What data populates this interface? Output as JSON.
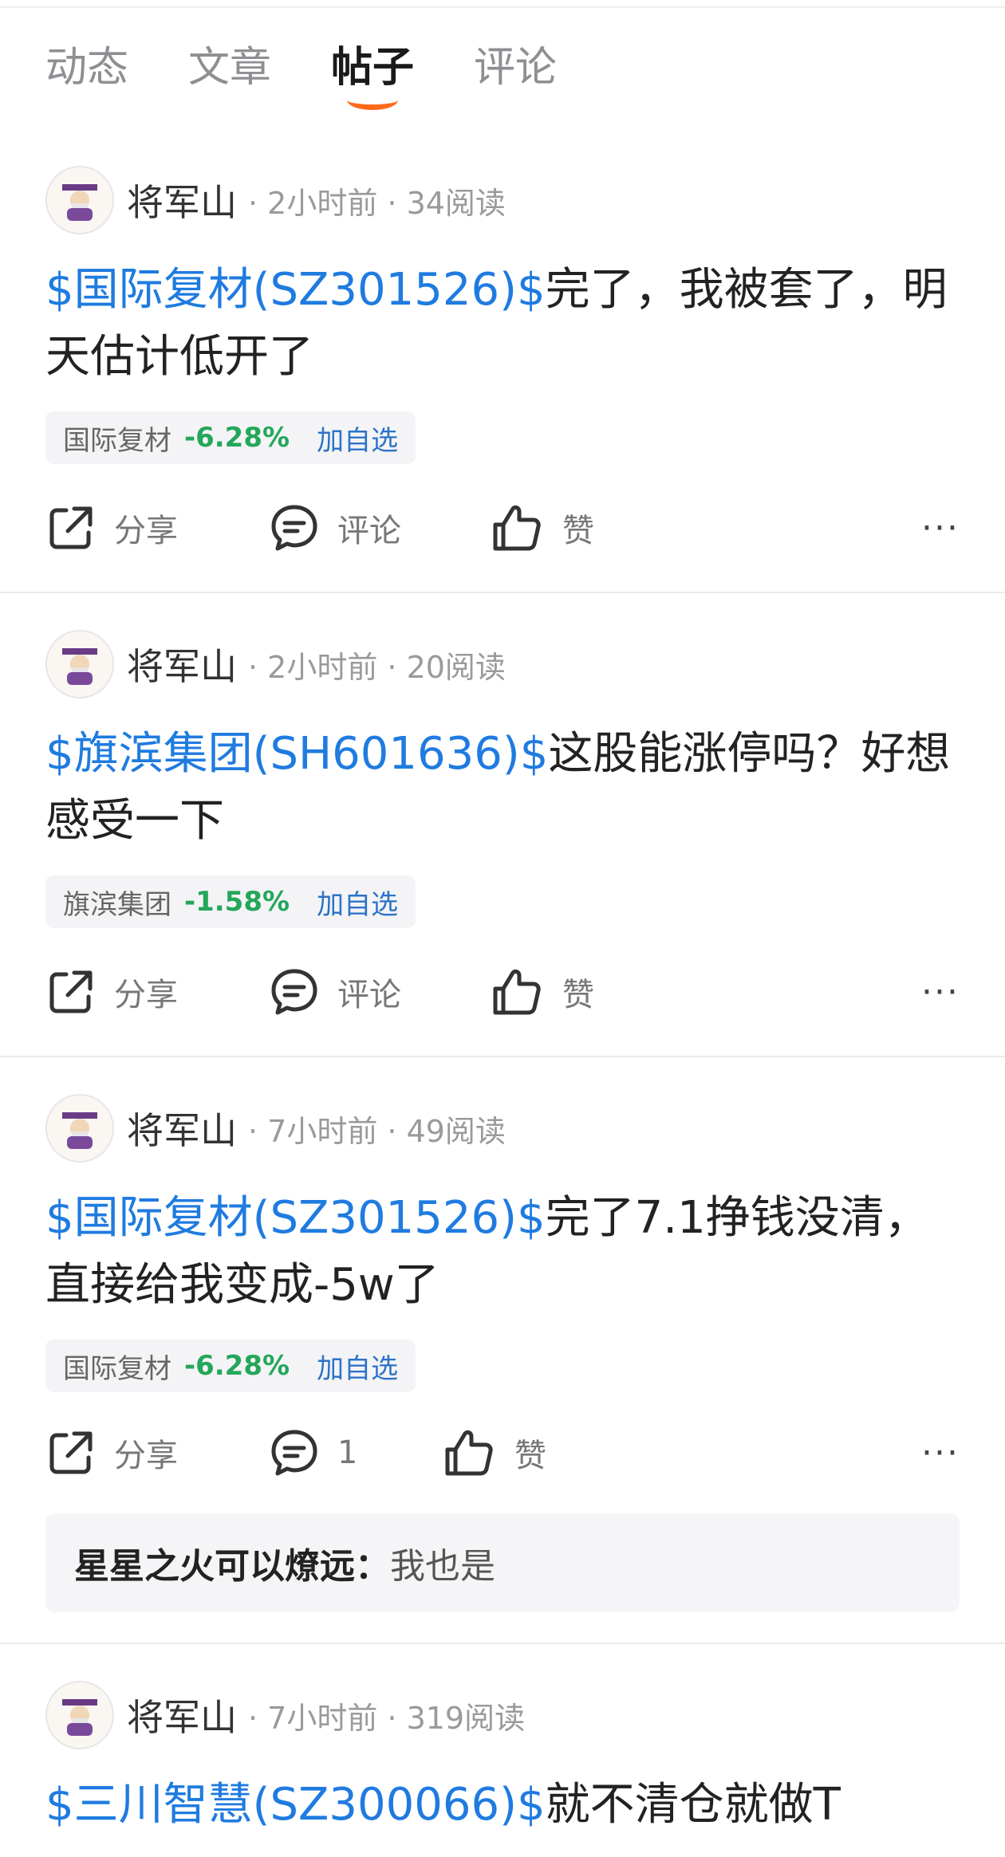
{
  "tabs": [
    "动态",
    "文章",
    "帖子",
    "评论"
  ],
  "actions": {
    "share": "分享",
    "comment": "评论",
    "like": "赞",
    "more": "···"
  },
  "posts": [
    {
      "author": "将军山",
      "meta": "· 2小时前 · 34阅读",
      "stock": "$国际复材(SZ301526)$",
      "text": "完了，我被套了，明天估计低开了",
      "quote_name": "国际复材",
      "quote_change": "-6.28%",
      "quote_add": "加自选",
      "comment_count": ""
    },
    {
      "author": "将军山",
      "meta": "· 2小时前 · 20阅读",
      "stock": "$旗滨集团(SH601636)$",
      "text": "这股能涨停吗？好想感受一下",
      "quote_name": "旗滨集团",
      "quote_change": "-1.58%",
      "quote_add": "加自选",
      "comment_count": ""
    },
    {
      "author": "将军山",
      "meta": "· 7小时前 · 49阅读",
      "stock": "$国际复材(SZ301526)$",
      "text": "完了7.1挣钱没清，直接给我变成-5w了",
      "quote_name": "国际复材",
      "quote_change": "-6.28%",
      "quote_add": "加自选",
      "comment_count": "1",
      "comment_user": "星星之火可以燎远",
      "comment_sep": "：",
      "comment_text": "我也是"
    },
    {
      "author": "将军山",
      "meta": "· 7小时前 · 319阅读",
      "stock": "$三川智慧(SZ300066)$",
      "text": "就不清仓就做T"
    }
  ],
  "colors": {
    "link": "#1f7be0",
    "down": "#24a75a",
    "accent": "#ff6a1a"
  }
}
